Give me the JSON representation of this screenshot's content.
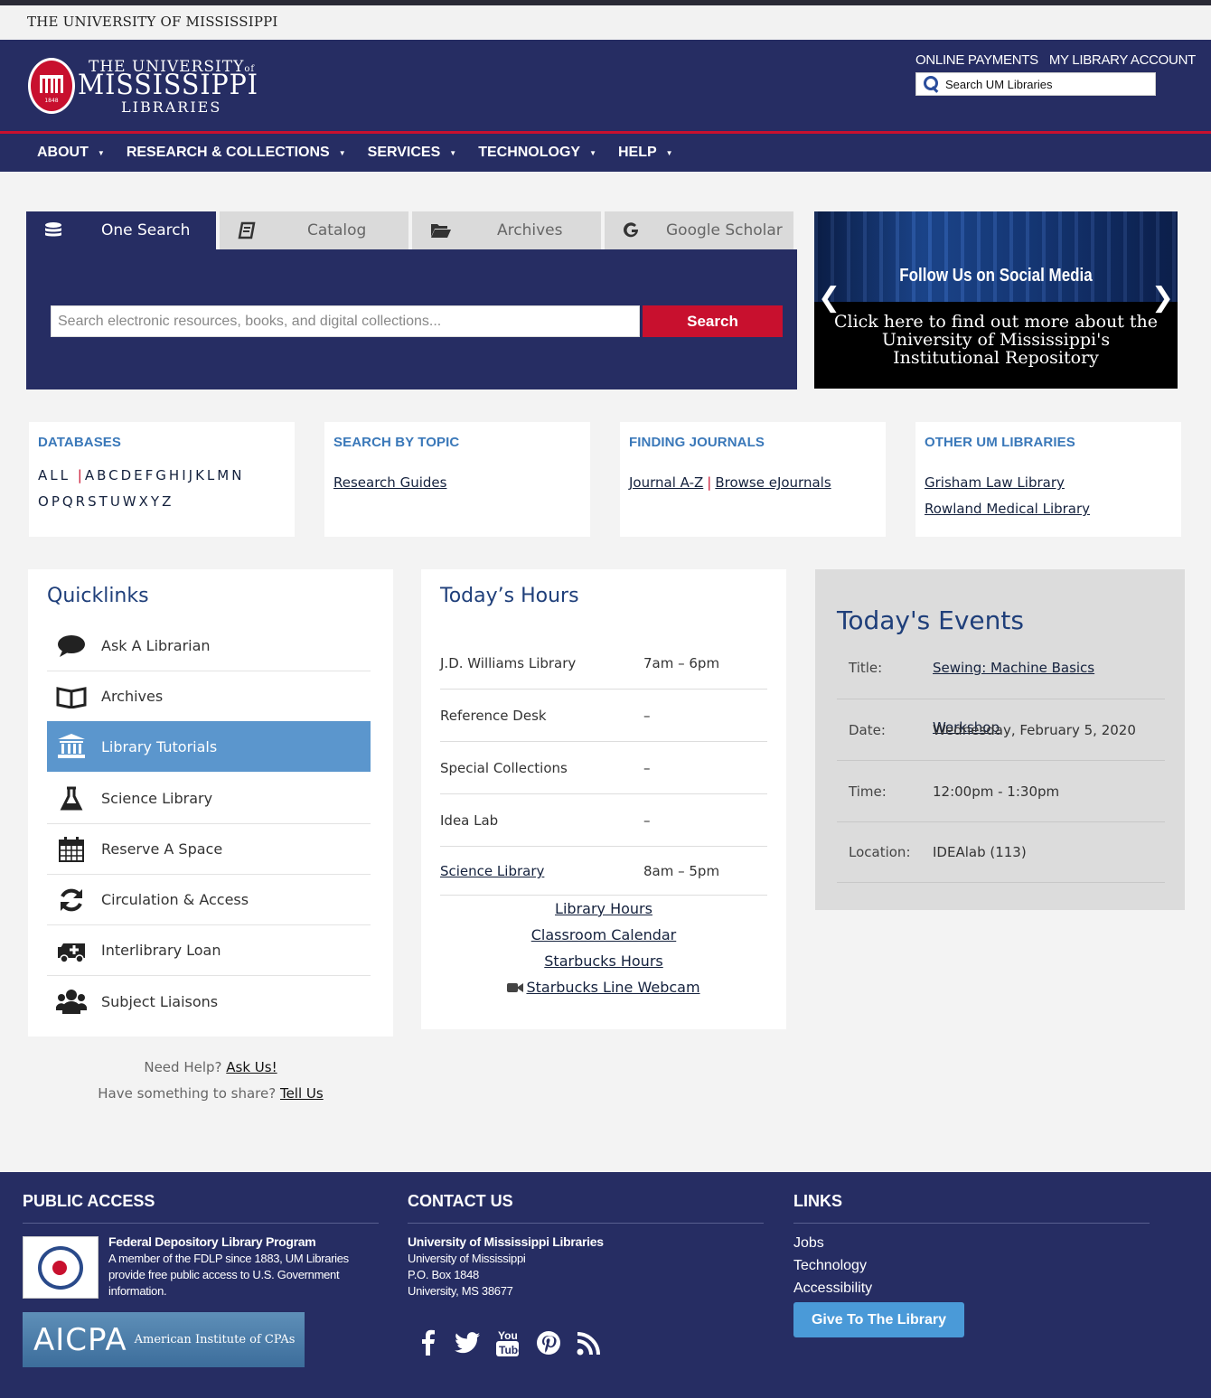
{
  "university_strip": "THE UNIVERSITY OF MISSISSIPPI",
  "logo": {
    "the_university": "THE UNIVERSITY",
    "of": "of",
    "mississippi": "MISSISSIPPI",
    "libraries": "LIBRARIES",
    "seal_year": "1848"
  },
  "header_links": {
    "online_payments": "ONLINE PAYMENTS",
    "my_account": "MY LIBRARY ACCOUNT"
  },
  "header_search": {
    "placeholder": "Search UM Libraries"
  },
  "nav": {
    "items": [
      {
        "label": "ABOUT"
      },
      {
        "label": "RESEARCH & COLLECTIONS"
      },
      {
        "label": "SERVICES"
      },
      {
        "label": "TECHNOLOGY"
      },
      {
        "label": "HELP"
      }
    ],
    "caret": "▼"
  },
  "search_tabs": [
    {
      "label": "One Search",
      "icon": "database-icon"
    },
    {
      "label": "Catalog",
      "icon": "book-icon"
    },
    {
      "label": "Archives",
      "icon": "folder-open-icon"
    },
    {
      "label": "Google Scholar",
      "icon": "google-icon"
    }
  ],
  "search": {
    "placeholder": "Search electronic resources, books, and digital collections...",
    "button": "Search"
  },
  "carousel": {
    "heading": "Follow Us on Social Media",
    "message_line1": "Click here to find out more about the",
    "message_line2": "University of Mississippi's",
    "message_line3": "Institutional Repository",
    "prev": "❮",
    "next": "❯"
  },
  "databases": {
    "title": "DATABASES",
    "all": "ALL",
    "row1": [
      "A",
      "B",
      "C",
      "D",
      "E",
      "F",
      "G",
      "H",
      "I",
      "J",
      "K",
      "L",
      "M",
      "N"
    ],
    "row2": [
      "O",
      "P",
      "Q",
      "R",
      "S",
      "T",
      "U",
      "W",
      "X",
      "Y",
      "Z"
    ]
  },
  "search_by_topic": {
    "title": "SEARCH BY TOPIC",
    "link": "Research Guides"
  },
  "finding_journals": {
    "title": "FINDING JOURNALS",
    "link1": "Journal A-Z",
    "link2": "Browse eJournals"
  },
  "other_libraries": {
    "title": "OTHER UM LIBRARIES",
    "link1": "Grisham Law Library",
    "link2": "Rowland Medical Library"
  },
  "quicklinks": {
    "title": "Quicklinks",
    "items": [
      {
        "label": "Ask A Librarian",
        "icon": "speech-bubble-icon"
      },
      {
        "label": "Archives",
        "icon": "open-book-icon"
      },
      {
        "label": "Library Tutorials",
        "icon": "institution-icon"
      },
      {
        "label": "Science Library",
        "icon": "flask-icon"
      },
      {
        "label": "Reserve A Space",
        "icon": "calendar-icon"
      },
      {
        "label": "Circulation & Access",
        "icon": "refresh-icon"
      },
      {
        "label": "Interlibrary Loan",
        "icon": "ambulance-icon"
      },
      {
        "label": "Subject Liaisons",
        "icon": "users-icon"
      }
    ]
  },
  "help": {
    "need_help": "Need Help?",
    "ask_us": "Ask Us!",
    "share": "Have something to share?",
    "tell_us": "Tell Us"
  },
  "hours": {
    "title": "Today’s Hours",
    "rows": [
      {
        "name": "J.D. Williams Library",
        "time": "7am – 6pm"
      },
      {
        "name": "Reference Desk",
        "time": "–"
      },
      {
        "name": "Special Collections",
        "time": "–"
      },
      {
        "name": "Idea Lab",
        "time": "–"
      },
      {
        "name": "Science Library",
        "time": "8am – 5pm"
      }
    ],
    "links": [
      "Library Hours",
      "Classroom Calendar",
      "Starbucks Hours",
      "Starbucks Line Webcam"
    ]
  },
  "events": {
    "title": "Today's Events",
    "rows": [
      {
        "key": "Title:",
        "value": "Sewing: Machine Basics Workshop"
      },
      {
        "key": "Date:",
        "value": "Wednesday, February 5, 2020"
      },
      {
        "key": "Time:",
        "value": "12:00pm - 1:30pm"
      },
      {
        "key": "Location:",
        "value": "IDEAlab (113)"
      }
    ]
  },
  "footer": {
    "public_access": {
      "title": "PUBLIC ACCESS",
      "fdlp_title": "Federal Depository Library Program",
      "fdlp_l1": "A member of the FDLP since 1883, UM Libraries",
      "fdlp_l2": "provide free public access to U.S. Government",
      "fdlp_l3": "information.",
      "aicpa": "AICPA",
      "aicpa_full": "American Institute of CPAs"
    },
    "contact": {
      "title": "CONTACT US",
      "name": "University of Mississippi Libraries",
      "l1": "University of Mississippi",
      "l2": "P.O. Box 1848",
      "l3": "University, MS 38677"
    },
    "social": [
      "facebook-icon",
      "twitter-icon",
      "youtube-icon",
      "pinterest-icon",
      "rss-icon"
    ],
    "links": {
      "title": "LINKS",
      "items": [
        "Jobs",
        "Technology",
        "Accessibility"
      ],
      "give": "Give To The Library"
    }
  },
  "colors": {
    "navy": "#262d63",
    "red": "#c8102e",
    "blue_heading": "#3a78b9",
    "active_blue": "#5b96cd",
    "events_bg": "#dcdcdc"
  }
}
